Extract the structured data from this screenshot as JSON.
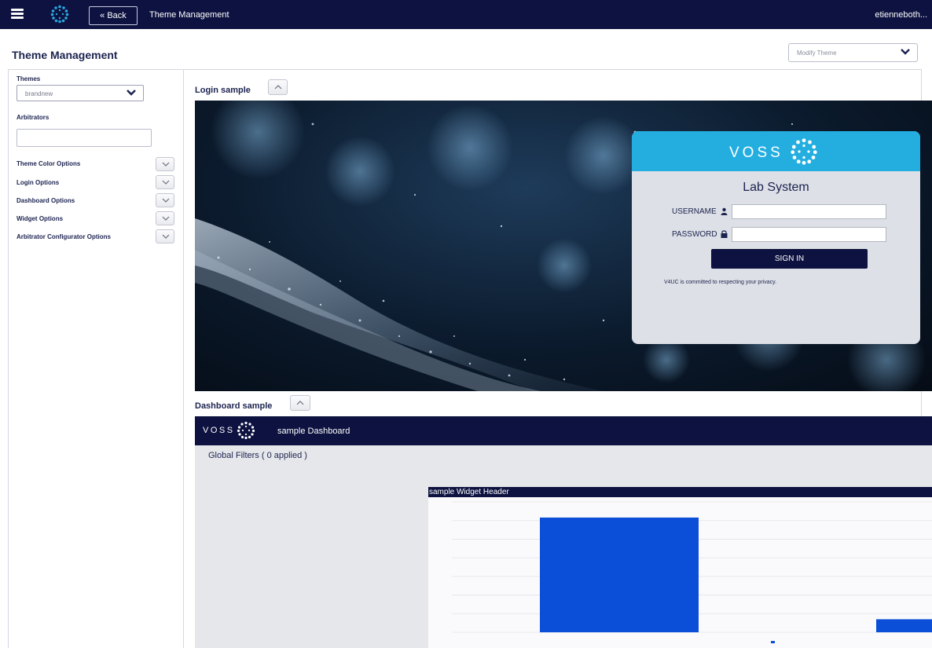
{
  "topbar": {
    "back_label": "« Back",
    "title": "Theme Management",
    "user": "etienneboth..."
  },
  "page": {
    "title": "Theme Management",
    "mode_select": "Modify Theme"
  },
  "sidebar": {
    "themes_label": "Themes",
    "themes_value": "brandnew",
    "arbitrators_label": "Arbitrators",
    "arbitrators_value": "",
    "options": [
      {
        "label": "Theme Color Options"
      },
      {
        "label": "Login Options"
      },
      {
        "label": "Dashboard Options"
      },
      {
        "label": "Widget Options"
      },
      {
        "label": "Arbitrator Configurator Options"
      }
    ]
  },
  "login_sample": {
    "section_title": "Login sample",
    "brand": "VOSS",
    "system_title": "Lab System",
    "username_label": "USERNAME",
    "password_label": "PASSWORD",
    "signin_label": "SIGN IN",
    "privacy_text": "V4UC is committed to respecting your privacy."
  },
  "dashboard_sample": {
    "section_title": "Dashboard sample",
    "brand": "VOSS",
    "title": "sample Dashboard",
    "global_filters": "Global Filters ( 0 applied )",
    "widget_header": "sample Widget Header"
  },
  "colors": {
    "navy": "#0d1240",
    "brand_blue": "#24aee0",
    "bar_blue": "#0b4ed8"
  },
  "chart_data": {
    "type": "bar",
    "categories": [
      "",
      ""
    ],
    "values": [
      88,
      10
    ],
    "ylim": [
      0,
      100
    ],
    "title": "",
    "xlabel": "",
    "ylabel": ""
  }
}
